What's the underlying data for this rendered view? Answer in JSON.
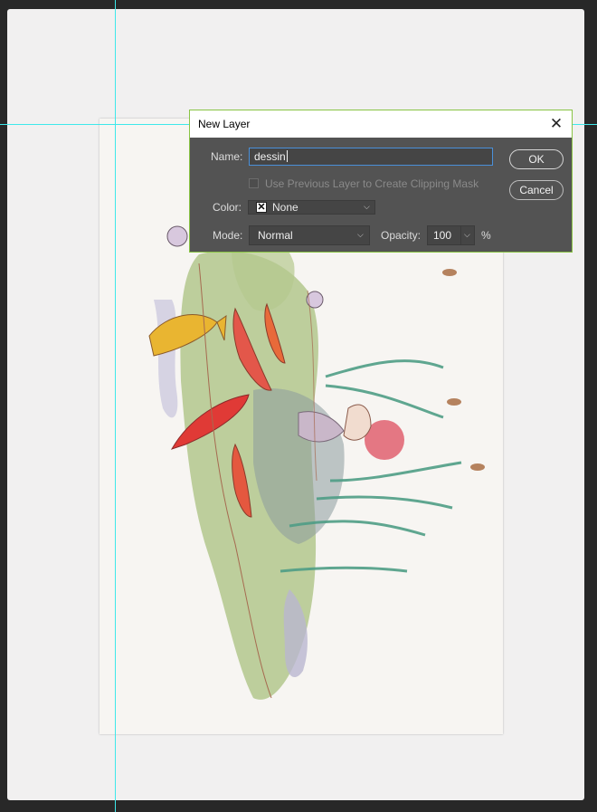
{
  "dialog": {
    "title": "New Layer",
    "close_glyph": "✕",
    "name_label": "Name:",
    "name_value": "dessin",
    "clipping_label": "Use Previous Layer to Create Clipping Mask",
    "color_label": "Color:",
    "color_value": "None",
    "color_icon_glyph": "✕",
    "mode_label": "Mode:",
    "mode_value": "Normal",
    "opacity_label": "Opacity:",
    "opacity_value": "100",
    "opacity_unit": "%",
    "ok_label": "OK",
    "cancel_label": "Cancel",
    "accent_color": "#89c444",
    "focus_color": "#4a90d9"
  },
  "icons": {
    "close": "close-icon",
    "color_swatch": "x-swatch-icon",
    "dropdown": "chevron-down-icon"
  }
}
